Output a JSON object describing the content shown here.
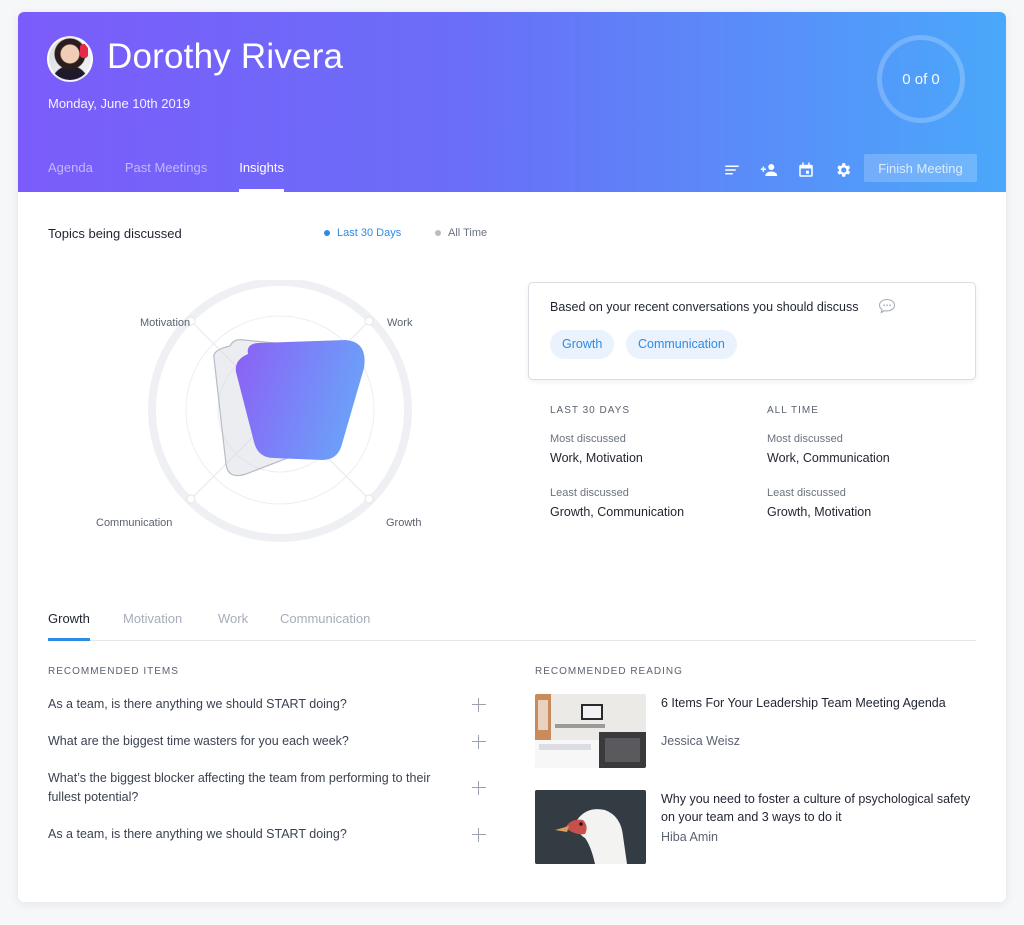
{
  "header": {
    "user_name": "Dorothy Rivera",
    "date": "Monday, June 10th 2019",
    "progress_text": "0 of 0",
    "tabs": [
      {
        "label": "Agenda",
        "active": false
      },
      {
        "label": "Past Meetings",
        "active": false
      },
      {
        "label": "Insights",
        "active": true
      }
    ],
    "toolbar_icons": [
      "notes-icon",
      "add-person-icon",
      "calendar-icon",
      "gear-icon"
    ],
    "finish_label": "Finish Meeting"
  },
  "insights": {
    "title": "Topics being discussed",
    "range_options": [
      {
        "label": "Last 30 Days",
        "active": true,
        "color": "#2f8ae6"
      },
      {
        "label": "All Time",
        "active": false,
        "color": "#b8bcc4"
      }
    ],
    "radar": {
      "axes": [
        "Motivation",
        "Work",
        "Growth",
        "Communication"
      ]
    },
    "suggestion": {
      "text": "Based on your recent conversations you should discuss",
      "chips": [
        "Growth",
        "Communication"
      ]
    },
    "stats": [
      {
        "heading": "LAST 30 DAYS",
        "most_label": "Most discussed",
        "most_value": "Work, Motivation",
        "least_label": "Least discussed",
        "least_value": "Growth, Communication"
      },
      {
        "heading": "ALL TIME",
        "most_label": "Most discussed",
        "most_value": "Work, Communication",
        "least_label": "Least discussed",
        "least_value": "Growth, Motivation"
      }
    ]
  },
  "topic_tabs": [
    {
      "label": "Growth",
      "active": true
    },
    {
      "label": "Motivation",
      "active": false
    },
    {
      "label": "Work",
      "active": false
    },
    {
      "label": "Communication",
      "active": false
    }
  ],
  "recommended_items": {
    "heading": "RECOMMENDED ITEMS",
    "items": [
      "As a team, is there anything we should START doing?",
      "What are the biggest time wasters for you each week?",
      "What’s the biggest blocker affecting the team from performing to their fullest potential?",
      "As a team, is there anything we should START doing?"
    ]
  },
  "recommended_reading": {
    "heading": "RECOMMENDED READING",
    "articles": [
      {
        "title": "6 Items For Your Leadership Team Meeting Agenda",
        "author": "Jessica Weisz"
      },
      {
        "title": "Why you need to foster a culture of psychological safety on your team and 3 ways to do it",
        "author": "Hiba Amin"
      }
    ]
  },
  "colors": {
    "accent": "#2f8ae6",
    "header_start": "#7b5cfa",
    "header_end": "#4aa8fa"
  }
}
